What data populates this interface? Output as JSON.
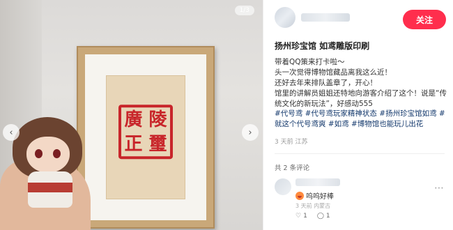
{
  "photo": {
    "counter": "1/3",
    "seal_chars": [
      "廣",
      "陵",
      "正",
      "璽"
    ]
  },
  "author": {
    "follow_label": "关注"
  },
  "post": {
    "title": "扬州珍宝馆 如鸢雕版印刷",
    "body_lines": [
      "带着QQ策来打卡啦～",
      "头一次觉得博物馆藏品离我这么近！",
      "还好去年来排队盖章了，开心！",
      "馆里的讲解员姐姐还特地向游客介绍了这个！说是“传统文化的新玩法”，好感动555"
    ],
    "tags": "#代号鸢 #代号鸢玩家精神状态 #扬州珍宝馆如鸢 #就这个代号鸢爽 #如鸢 #博物馆也能玩儿出花",
    "meta": "3 天前 江苏"
  },
  "comments": {
    "count_label": "共 2 条评论",
    "items": [
      {
        "text": "呜呜好棒",
        "meta": "3 天前 内蒙古",
        "likes": "1",
        "replies": "1"
      }
    ]
  },
  "colors": {
    "accent": "#ff2e4d",
    "tag": "#13386c",
    "seal": "#c8252a"
  }
}
